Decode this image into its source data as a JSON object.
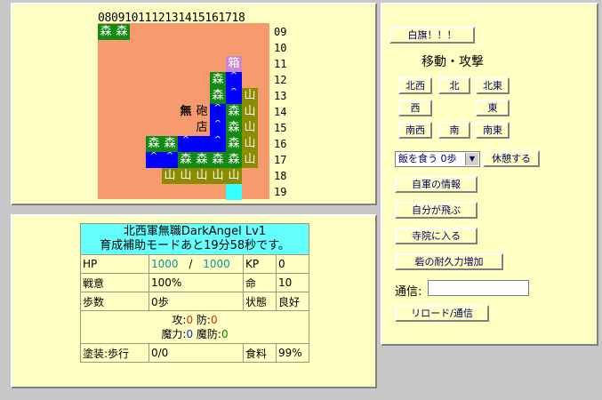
{
  "map": {
    "col_header": "080910111213141516171​8",
    "row_labels": [
      "09",
      "10",
      "11",
      "12",
      "13",
      "14",
      "15",
      "16",
      "17",
      "18",
      "19"
    ],
    "glyphs": {
      "forest": "森",
      "mountain": "山",
      "shop": "店",
      "box": "箱",
      "mu": "無",
      "cannon": "砲",
      "road_arrow": "^"
    }
  },
  "status": {
    "title_line1": "北西軍無職DarkAngel Lv1",
    "title_line2": "育成補助モードあと19分58秒です。",
    "hp_label": "HP",
    "hp_current": "1000",
    "hp_sep": "/",
    "hp_max": "1000",
    "kp_label": "KP",
    "kp_value": "0",
    "morale_label": "戦意",
    "morale_value": "100%",
    "life_label": "命",
    "life_value": "10",
    "steps_label": "歩数",
    "steps_value": "0歩",
    "state_label": "状態",
    "state_value": "良好",
    "atk_label": "攻:",
    "atk_value": "0",
    "def_label": "防:",
    "def_value": "0",
    "mag_label": "魔力:",
    "mag_value": "0",
    "mdef_label": "魔防:",
    "mdef_value": "0",
    "armor_label": "塗装:歩行",
    "armor_value": "0/0",
    "food_label": "食料",
    "food_value": "99%"
  },
  "commands": {
    "white_flag": "白旗！！！",
    "move_attack": "移動・攻撃",
    "nw": "北西",
    "n": "北",
    "ne": "北東",
    "w": "西",
    "e": "東",
    "sw": "南西",
    "s": "南",
    "se": "南東",
    "eat_select": "飯を食う 0歩",
    "rest": "休憩する",
    "army_info": "自軍の情報",
    "fly": "自分が飛ぶ",
    "enter_temple": "寺院に入る",
    "fort_durability": "砦の耐久力増加",
    "comm_label": "通信:",
    "reload": "リロード/通信"
  }
}
